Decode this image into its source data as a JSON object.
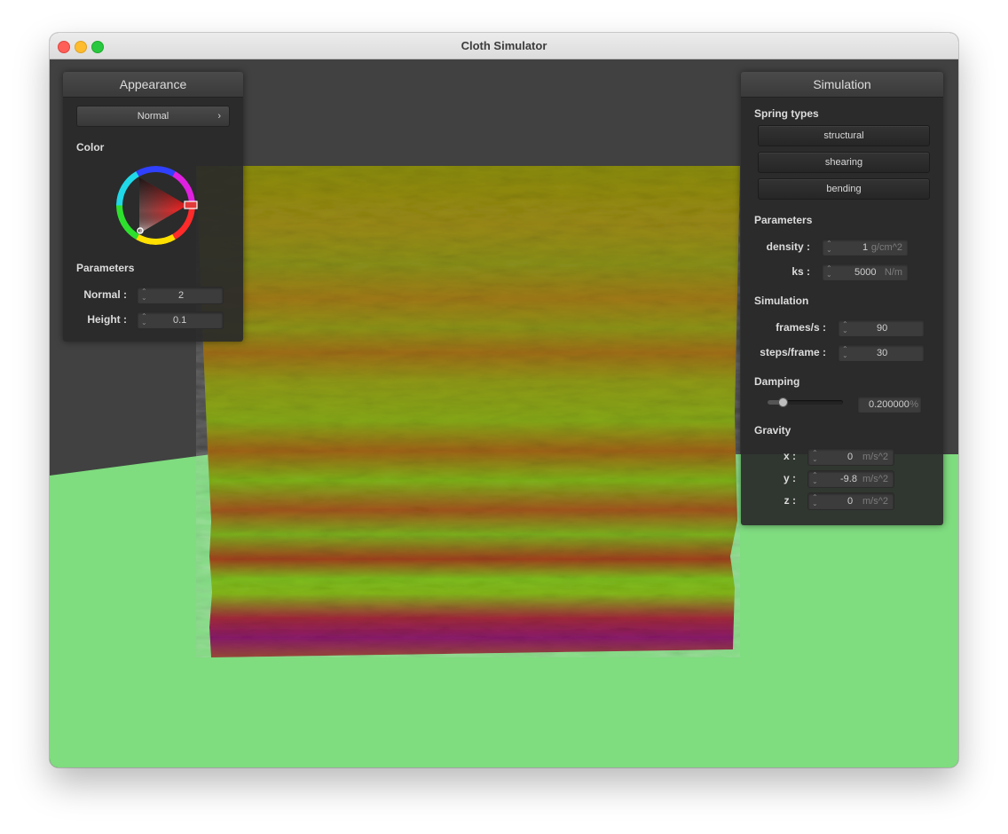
{
  "window": {
    "title": "Cloth Simulator",
    "traffic_lights": {
      "close_color": "#ff5f57",
      "minimize_color": "#febc2e",
      "zoom_color": "#28c840"
    }
  },
  "scene": {
    "background_color": "#414141",
    "floor_color": "#7fdc7f"
  },
  "appearance": {
    "title": "Appearance",
    "shader_select": "Normal",
    "color_label": "Color",
    "color_wheel_icon": "color-wheel-icon",
    "selected_color": "#e03a3a",
    "params_label": "Parameters",
    "normal": {
      "label": "Normal :",
      "value": "2"
    },
    "height": {
      "label": "Height :",
      "value": "0.1"
    }
  },
  "simulation": {
    "title": "Simulation",
    "spring_types_label": "Spring types",
    "springs": [
      "structural",
      "shearing",
      "bending"
    ],
    "params_label": "Parameters",
    "density": {
      "label": "density :",
      "value": "1",
      "unit": "g/cm^2"
    },
    "ks": {
      "label": "ks :",
      "value": "5000",
      "unit": "N/m"
    },
    "sim_label": "Simulation",
    "fps": {
      "label": "frames/s :",
      "value": "90"
    },
    "steps": {
      "label": "steps/frame :",
      "value": "30"
    },
    "damping_label": "Damping",
    "damping": {
      "value": "0.200000",
      "unit": "%",
      "level_fraction": 0.2
    },
    "gravity_label": "Gravity",
    "gx": {
      "label": "x :",
      "value": "0",
      "unit": "m/s^2"
    },
    "gy": {
      "label": "y :",
      "value": "-9.8",
      "unit": "m/s^2"
    },
    "gz": {
      "label": "z :",
      "value": "0",
      "unit": "m/s^2"
    }
  }
}
